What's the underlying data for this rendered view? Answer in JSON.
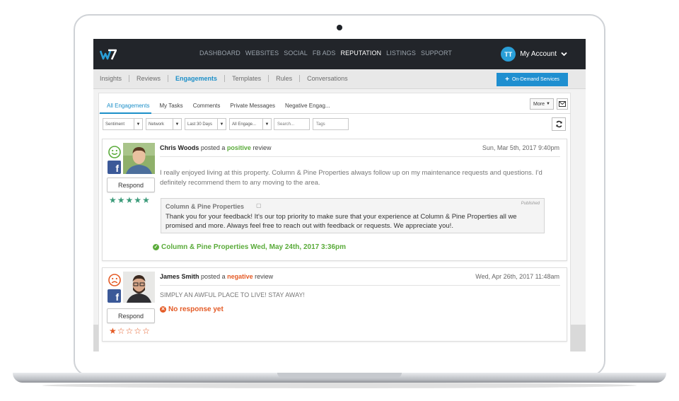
{
  "colors": {
    "accent": "#1c8fc8",
    "positive": "#5aab3a",
    "negative": "#e45a25",
    "nav_bg": "#22252a",
    "facebook": "#3b5998"
  },
  "topnav": {
    "links": [
      "DASHBOARD",
      "WEBSITES",
      "SOCIAL",
      "FB ADS",
      "REPUTATION",
      "LISTINGS",
      "SUPPORT"
    ],
    "active_link": "REPUTATION",
    "account_initials": "TT",
    "account_label": "My Account"
  },
  "subnav": {
    "tabs": [
      "Insights",
      "Reviews",
      "Engagements",
      "Templates",
      "Rules",
      "Conversations"
    ],
    "active_tab": "Engagements",
    "ondemand_label": "On-Demand Services"
  },
  "engagement_tabs": {
    "tabs": [
      "All Engagements",
      "My Tasks",
      "Comments",
      "Private Messages",
      "Negative Engag..."
    ],
    "active_tab": "All Engagements",
    "more_label": "More"
  },
  "filters": {
    "sentiment": "Sentiment",
    "network": "Network",
    "date_range": "Last 30 Days",
    "engagement_type": "All Engage...",
    "search_placeholder": "Search...",
    "tags_placeholder": "Tags"
  },
  "reviews": [
    {
      "author": "Chris Woods",
      "posted_a": "posted a",
      "sentiment": "positive",
      "review_word": "review",
      "date": "Sun, Mar 5th, 2017 9:40pm",
      "sentiment_icon": "smile-icon",
      "network_icon": "facebook-icon",
      "rating": 5,
      "text": "I really enjoyed living at this property. Column & Pine Properties always follow up on my maintenance requests and questions. I'd definitely recommend them to any moving to the area.",
      "respond_label": "Respond",
      "reply": {
        "name": "Column & Pine Properties",
        "status": "Published",
        "text": "Thank you for your feedback! It's our top priority to make sure that your experience at Column & Pine Properties all we promised and more. Always feel free to reach out with feedback or requests. We appreciate you!."
      },
      "response_meta": "Column & Pine Properties Wed, May 24th, 2017 3:36pm"
    },
    {
      "author": "James Smith",
      "posted_a": "posted a",
      "sentiment": "negative",
      "review_word": "review",
      "date": "Wed, Apr 26th, 2017 11:48am",
      "sentiment_icon": "frown-icon",
      "network_icon": "facebook-icon",
      "rating": 1,
      "text": "SIMPLY AN AWFUL PLACE TO LIVE! STAY AWAY!",
      "respond_label": "Respond",
      "response_status": "No response yet"
    }
  ]
}
